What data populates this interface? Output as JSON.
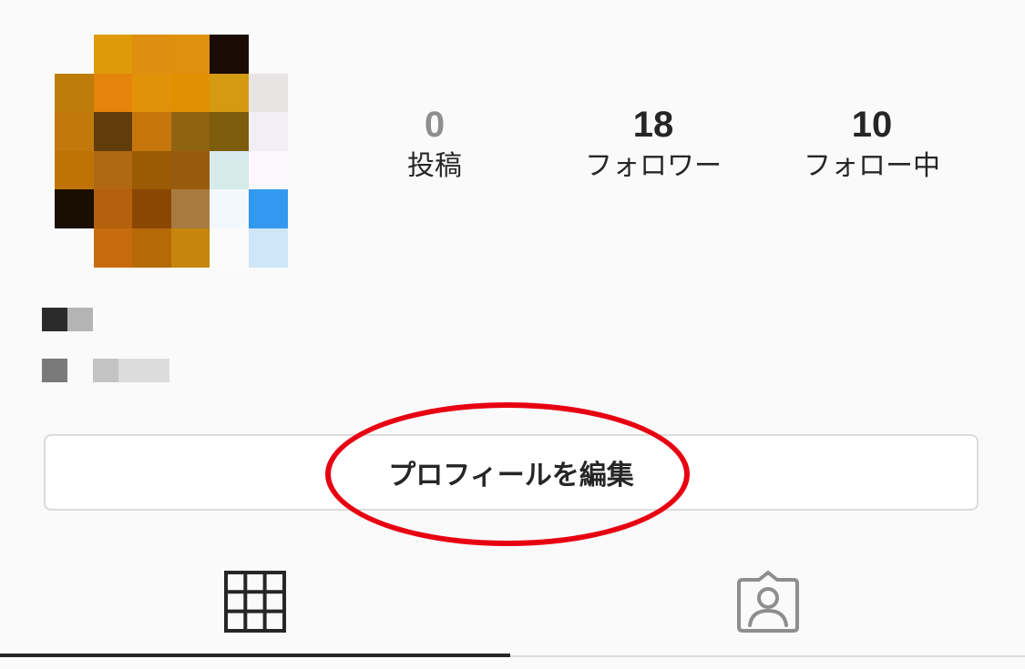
{
  "profile": {
    "avatar": {
      "kind": "pixelated-photo",
      "pixels": [
        [
          "#fafafa",
          "#df9a0a",
          "#df8e10",
          "#e0900e",
          "#1a0c04",
          "#fafafa"
        ],
        [
          "#be7d0a",
          "#e4840c",
          "#e29208",
          "#e19002",
          "#d49a12",
          "#e8e4e4"
        ],
        [
          "#c2780c",
          "#623d0c",
          "#c6760c",
          "#8f6310",
          "#7d5c0c",
          "#f1eef6"
        ],
        [
          "#be7304",
          "#b06812",
          "#9b5a04",
          "#985a0c",
          "#d6e9eb",
          "#fcf8fc"
        ],
        [
          "#1a0e02",
          "#b4600c",
          "#8a4704",
          "#a87a40",
          "#f2f8fe",
          "#3399f0"
        ],
        [
          "#fafafa",
          "#c76b0f",
          "#b46b07",
          "#c6850d",
          "#fbfbfb",
          "#cfe5f8"
        ]
      ]
    },
    "stats": [
      {
        "count": "0",
        "label": "投稿"
      },
      {
        "count": "18",
        "label": "フォロワー"
      },
      {
        "count": "10",
        "label": "フォロー中"
      }
    ],
    "edit_button_label": "プロフィールを編集",
    "highlight_color": "#e60012"
  },
  "tabs": [
    {
      "icon": "grid-icon",
      "active": true
    },
    {
      "icon": "tagged-user-icon",
      "active": false
    }
  ]
}
